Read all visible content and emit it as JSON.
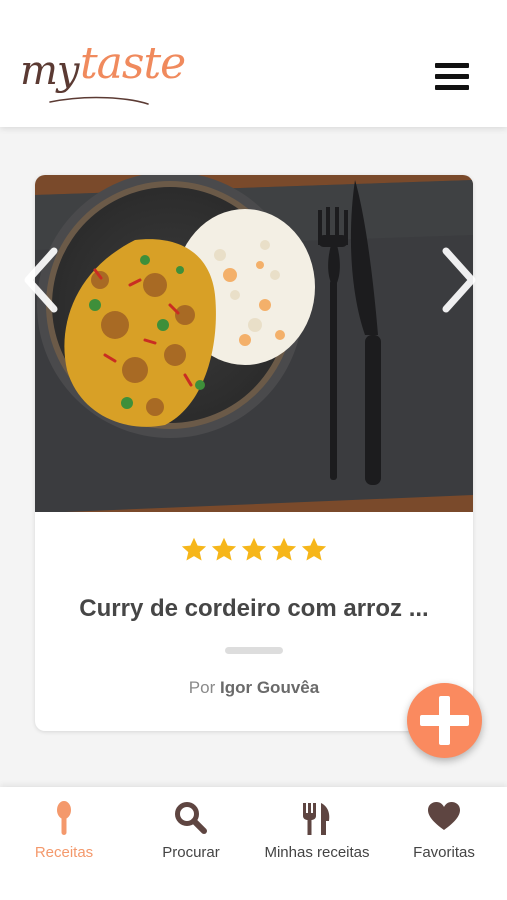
{
  "header": {
    "logo": {
      "part1": "my",
      "part2": "taste"
    },
    "menu_icon": "hamburger-menu-icon"
  },
  "recipe_card": {
    "image_alt": "Curry de cordeiro com arroz",
    "rating": 5,
    "rating_max": 5,
    "title": "Curry de cordeiro com arroz ...",
    "author_prefix": "Por",
    "author_name": "Igor Gouvêa",
    "prev_icon": "chevron-left-icon",
    "next_icon": "chevron-right-icon"
  },
  "fab": {
    "icon": "plus-icon"
  },
  "bottom_nav": {
    "items": [
      {
        "label": "Receitas",
        "icon": "spoon-icon",
        "active": true
      },
      {
        "label": "Procurar",
        "icon": "search-icon",
        "active": false
      },
      {
        "label": "Minhas receitas",
        "icon": "fork-knife-icon",
        "active": false
      },
      {
        "label": "Favoritas",
        "icon": "heart-icon",
        "active": false
      }
    ]
  },
  "colors": {
    "accent": "#fa8a5f",
    "logo_brown": "#5b3a33",
    "star": "#f6b61a",
    "nav_icon": "#5e4541",
    "title_text": "#464646"
  }
}
